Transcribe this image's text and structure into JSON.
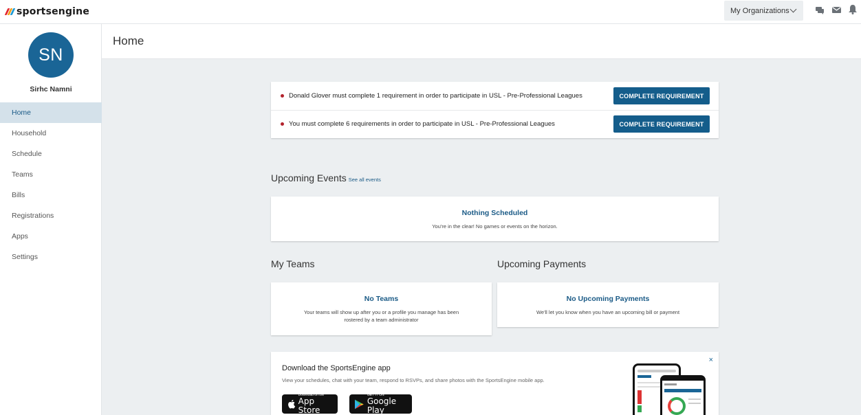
{
  "app": {
    "logo_text": "sportsengine",
    "colors": {
      "brand": "#1a6596",
      "button": "#145d8b",
      "alert_dot": "#b3232d",
      "active_nav": "#d4e1ea"
    }
  },
  "topbar": {
    "org_button_label": "My Organizations",
    "icons": [
      "chat-icon",
      "mail-icon",
      "bell-icon"
    ]
  },
  "user": {
    "initials": "SN",
    "name": "Sirhc Namni"
  },
  "sidebar": {
    "items": [
      {
        "label": "Home",
        "active": true
      },
      {
        "label": "Household"
      },
      {
        "label": "Schedule"
      },
      {
        "label": "Teams"
      },
      {
        "label": "Bills"
      },
      {
        "label": "Registrations"
      },
      {
        "label": "Apps"
      },
      {
        "label": "Settings"
      }
    ]
  },
  "page": {
    "title": "Home"
  },
  "requirements": [
    {
      "text": "Donald Glover must complete 1 requirement in order to participate in USL - Pre-Professional Leagues",
      "button": "COMPLETE REQUIREMENT"
    },
    {
      "text": "You must complete 6 requirements in order to participate in USL - Pre-Professional Leagues",
      "button": "COMPLETE REQUIREMENT"
    }
  ],
  "upcoming_events": {
    "title": "Upcoming Events",
    "link": "See all events",
    "empty_title": "Nothing Scheduled",
    "empty_desc": "You're in the clear! No games or events on the horizon."
  },
  "my_teams": {
    "title": "My Teams",
    "empty_title": "No Teams",
    "empty_desc_line1": "Your teams will show up after you or a profile you manage has been",
    "empty_desc_line2": "rostered by a team administrator"
  },
  "upcoming_payments": {
    "title": "Upcoming Payments",
    "empty_title": "No Upcoming Payments",
    "empty_desc": "We'll let you know when you have an upcoming bill or payment"
  },
  "download_app": {
    "title": "Download the SportsEngine app",
    "desc": "View your schedules, chat with your team, respond to RSVPs, and share photos with the SportsEngine mobile app.",
    "close": "×",
    "app_store_small": "Download on the",
    "app_store_big": "App Store",
    "google_play_small": "GET IT ON",
    "google_play_big": "Google Play"
  }
}
